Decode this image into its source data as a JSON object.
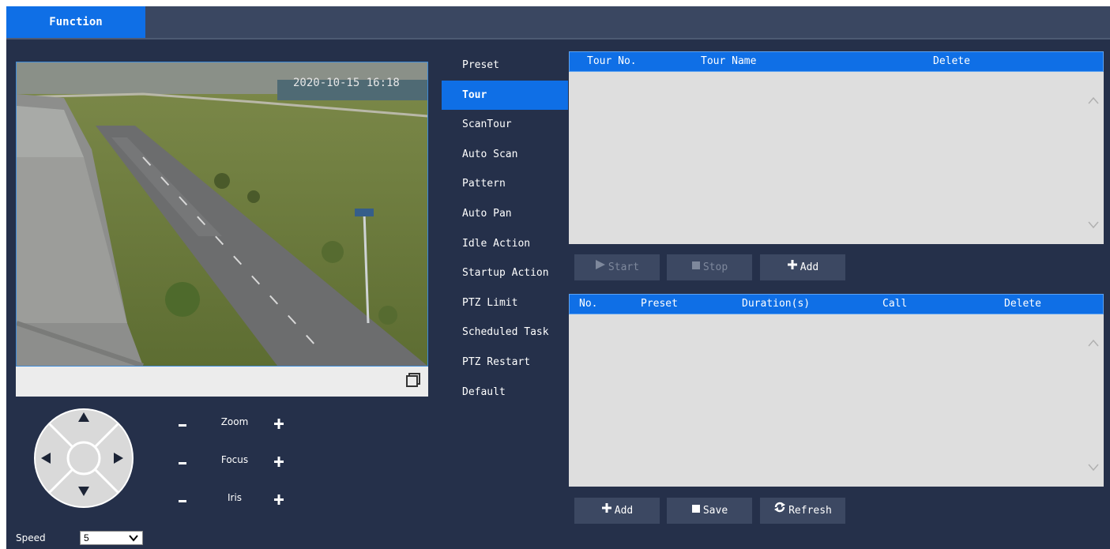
{
  "header": {
    "tab_label": "Function"
  },
  "menu": {
    "items": [
      {
        "label": "Preset"
      },
      {
        "label": "Tour"
      },
      {
        "label": "ScanTour"
      },
      {
        "label": "Auto Scan"
      },
      {
        "label": "Pattern"
      },
      {
        "label": "Auto Pan"
      },
      {
        "label": "Idle Action"
      },
      {
        "label": "Startup Action"
      },
      {
        "label": "PTZ Limit"
      },
      {
        "label": "Scheduled Task"
      },
      {
        "label": "PTZ Restart"
      },
      {
        "label": "Default"
      }
    ],
    "active": "Tour"
  },
  "ptz": {
    "zoom_label": "Zoom",
    "focus_label": "Focus",
    "iris_label": "Iris",
    "minus": "−",
    "plus": "+",
    "speed_label": "Speed",
    "speed_value": "5"
  },
  "tour_table": {
    "columns": [
      "Tour No.",
      "Tour Name",
      "Delete"
    ],
    "rows": []
  },
  "tour_buttons": {
    "start": "Start",
    "stop": "Stop",
    "add": "Add"
  },
  "preset_table": {
    "columns": [
      "No.",
      "Preset",
      "Duration(s)",
      "Call",
      "Delete"
    ],
    "rows": []
  },
  "preset_buttons": {
    "add": "Add",
    "save": "Save",
    "refresh": "Refresh"
  },
  "colors": {
    "accent": "#0f6fe6",
    "panel_bg": "#25304a",
    "button_bg": "#3c4862",
    "table_bg": "#dedede"
  }
}
